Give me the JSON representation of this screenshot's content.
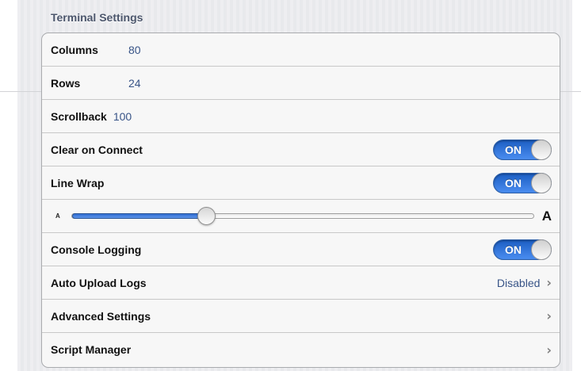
{
  "section_title": "Terminal Settings",
  "columns": {
    "label": "Columns",
    "value": "80"
  },
  "rows": {
    "label": "Rows",
    "value": "24"
  },
  "scrollback": {
    "label": "Scrollback",
    "value": "100"
  },
  "clear_on_connect": {
    "label": "Clear on Connect",
    "state": "ON"
  },
  "line_wrap": {
    "label": "Line Wrap",
    "state": "ON"
  },
  "font_size_slider": {
    "min_label": "A",
    "max_label": "A",
    "level_fraction": 0.29
  },
  "console_logging": {
    "label": "Console Logging",
    "state": "ON"
  },
  "auto_upload_logs": {
    "label": "Auto Upload Logs",
    "value": "Disabled"
  },
  "advanced_settings": {
    "label": "Advanced Settings"
  },
  "script_manager": {
    "label": "Script Manager"
  },
  "icons": {
    "disclosure": "chevron-right-icon"
  },
  "colors": {
    "toggle_on": "#2f6bd0",
    "value_text": "#385487"
  }
}
